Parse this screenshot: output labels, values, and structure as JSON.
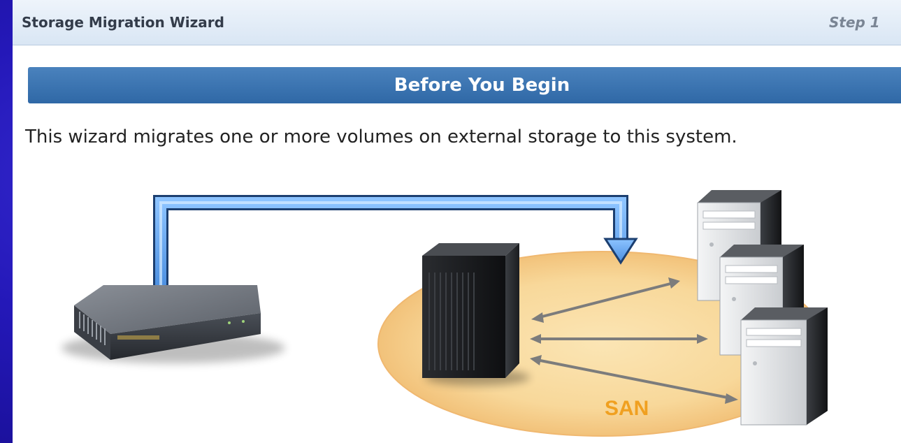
{
  "wizard": {
    "title": "Storage Migration Wizard",
    "step": "Step 1"
  },
  "section": {
    "title": "Before You Begin"
  },
  "intro": {
    "text": "This wizard migrates one or more volumes on external storage to this system."
  },
  "diagram": {
    "network_label": "SAN",
    "icons": [
      "external-storage-icon",
      "storage-system-icon",
      "host-server-icon",
      "host-server-icon",
      "host-server-icon"
    ],
    "colors": {
      "accent_bar": "#3a74b2",
      "arrow_blue": "#5a9be8",
      "san_zone": "#f7d79a",
      "san_text": "#f0a020"
    }
  }
}
